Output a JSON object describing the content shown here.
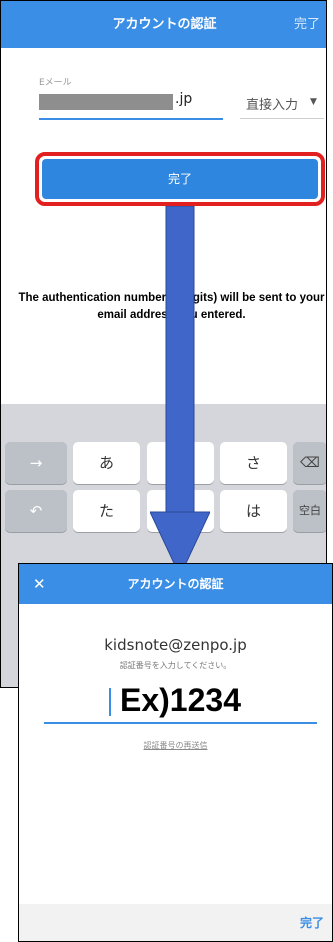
{
  "screen1": {
    "header": {
      "title": "アカウントの認証",
      "done_label": "完了"
    },
    "email": {
      "label": "Eメール",
      "suffix": ".jp"
    },
    "domain_select": {
      "label": "直接入力"
    },
    "done_button": {
      "label": "完了"
    },
    "keyboard": {
      "row1": [
        "→",
        "あ",
        "さ"
      ],
      "row2": [
        "た",
        "は",
        "空白"
      ]
    }
  },
  "annotation": {
    "info_text": "The authentication number (4 digits) will be sent to your email address you entered."
  },
  "screen2": {
    "header": {
      "title": "アカウントの認証"
    },
    "email": "kidsnote@zenpo.jp",
    "hint": "認証番号を入力してください。",
    "code_example": "Ex)1234",
    "resend_link": "認証番号の再送信",
    "footer_done": "完了"
  },
  "colors": {
    "accent": "#3a8ee6",
    "highlight_border": "#e32020",
    "arrow": "#3f66c8"
  }
}
